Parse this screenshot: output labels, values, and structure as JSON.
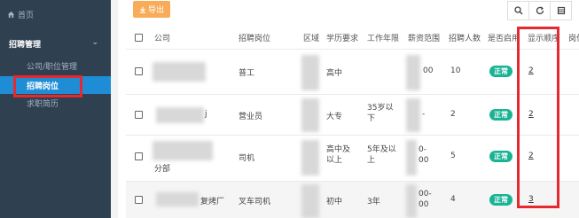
{
  "sidebar": {
    "home_label": "首页",
    "group_label": "招聘管理",
    "items": [
      {
        "label": "公司/职位管理"
      },
      {
        "label": "招聘岗位"
      },
      {
        "label": "求职简历"
      }
    ]
  },
  "toolbar": {
    "export_label": "导出"
  },
  "table": {
    "headers": [
      "公司",
      "招聘岗位",
      "区域",
      "学历要求",
      "工作年限",
      "薪资范围",
      "招聘人数",
      "是否启用",
      "显示顺序",
      "岗位"
    ],
    "rows": [
      {
        "company": "",
        "position": "普工",
        "education": "高中",
        "years": "",
        "salary": "00",
        "count": "10",
        "status": "正常",
        "order": "2"
      },
      {
        "company": "j",
        "position": "营业员",
        "education": "大专",
        "years": "35岁以下",
        "salary": "-",
        "count": "2",
        "status": "正常",
        "order": "2"
      },
      {
        "company": "分部",
        "position": "司机",
        "education": "高中及以上",
        "years": "5年及以上",
        "salary": "0-00",
        "count": "5",
        "status": "正常",
        "order": "2"
      },
      {
        "company": "复烤厂",
        "position": "叉车司机",
        "education": "初中",
        "years": "3年",
        "salary": "00-00",
        "count": "4",
        "status": "正常",
        "order": "3"
      }
    ]
  },
  "colors": {
    "sidebar_bg": "#2f4050",
    "active": "#1f8dd6",
    "export": "#f8ac59",
    "badge": "#1ab394",
    "highlight": "#e6282f"
  }
}
